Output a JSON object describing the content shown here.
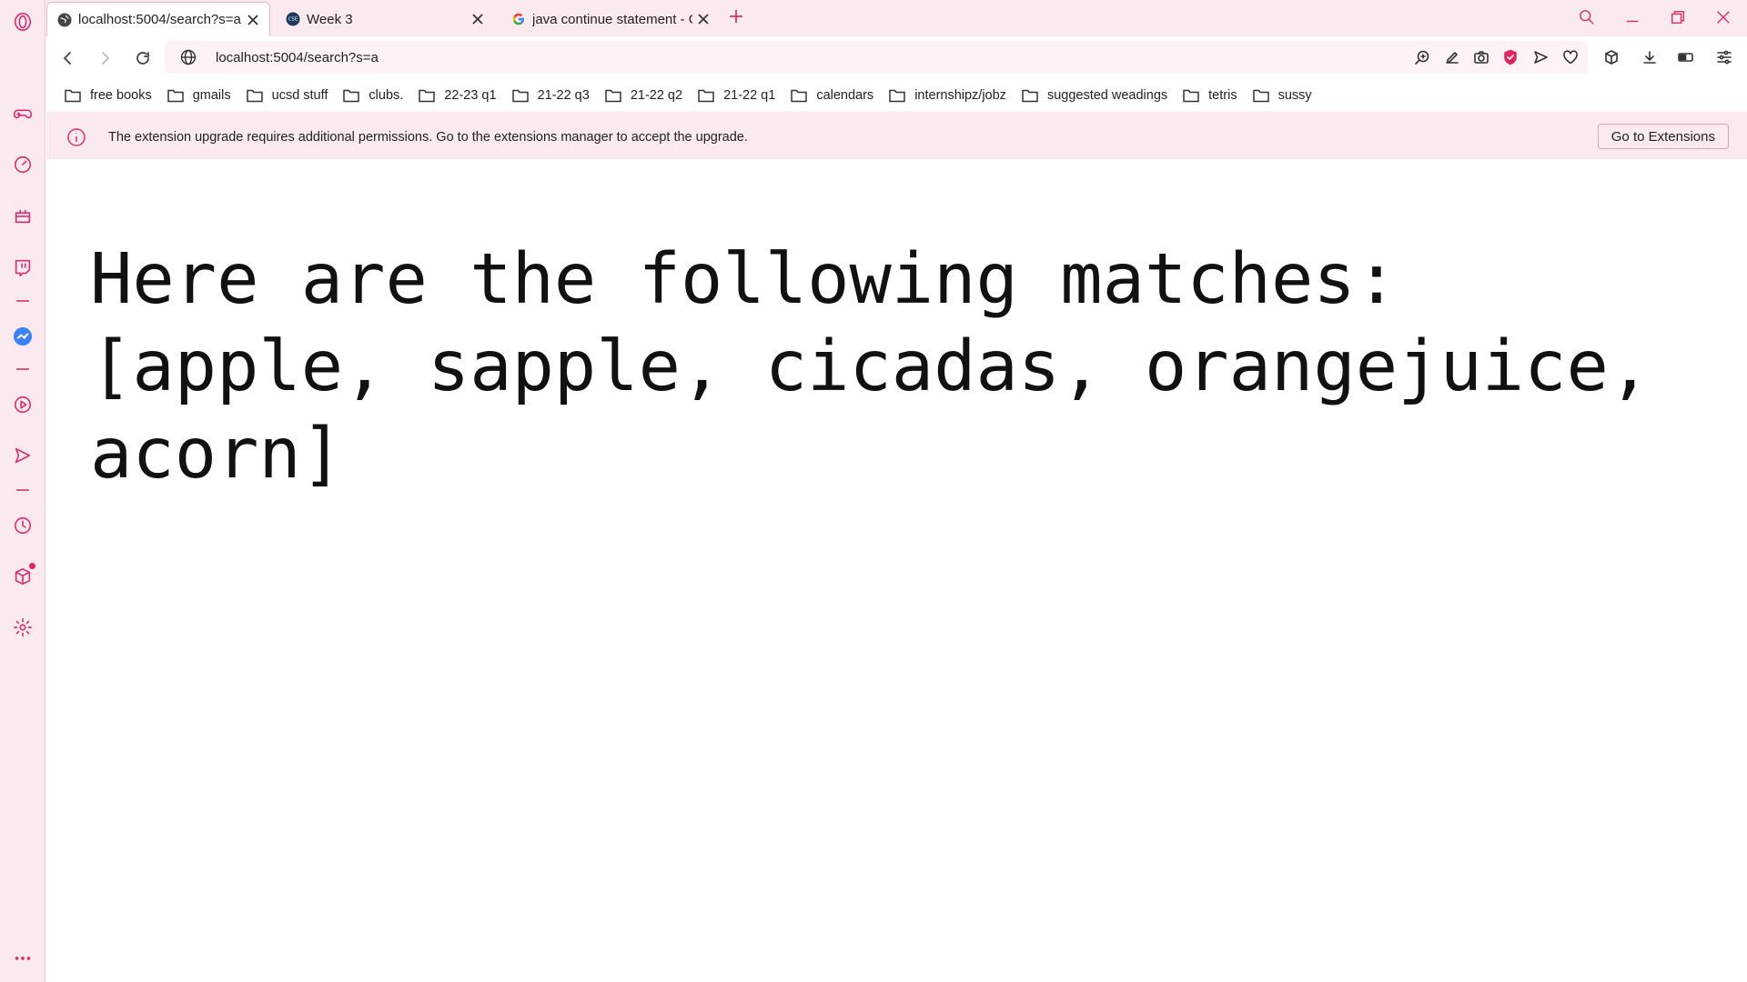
{
  "tabs": [
    {
      "title": "localhost:5004/search?s=a",
      "favicon": "globe-icon",
      "active": true
    },
    {
      "title": "Week 3",
      "favicon": "cse-logo-icon",
      "active": false
    },
    {
      "title": "java continue statement - G",
      "favicon": "google-icon",
      "active": false
    }
  ],
  "address_bar": {
    "url": "localhost:5004/search?s=a"
  },
  "bookmarks": [
    "free books",
    "gmails",
    "ucsd stuff",
    "clubs.",
    "22-23 q1",
    "21-22 q3",
    "21-22 q2",
    "21-22 q1",
    "calendars",
    "internshipz/jobz",
    "suggested weadings",
    "tetris",
    "sussy"
  ],
  "infobar": {
    "message": "The extension upgrade requires additional permissions. Go to the extensions manager to accept the upgrade.",
    "button_label": "Go to Extensions"
  },
  "page": {
    "result_text": "Here are the following matches:[apple, sapple, cicadas, orangejuice, acorn]"
  },
  "sidebar_icons": [
    "opera-logo-icon",
    "gamepad-icon",
    "speed-dial-icon",
    "gift-icon",
    "twitch-icon",
    "messenger-icon",
    "player-icon",
    "send-icon",
    "history-icon",
    "extensions-icon",
    "settings-icon",
    "more-icon"
  ],
  "colors": {
    "accent": "#d6336c",
    "chrome_bg": "#fbe9f0"
  }
}
